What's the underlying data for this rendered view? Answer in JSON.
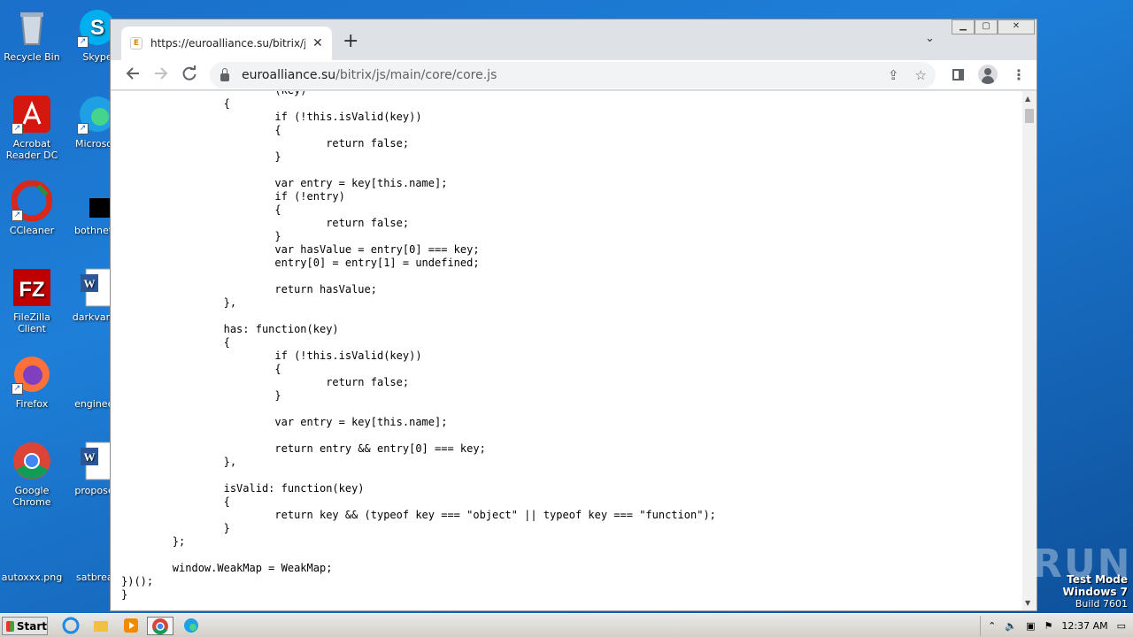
{
  "desktop": {
    "icons": [
      {
        "label": "Recycle Bin"
      },
      {
        "label": "Skype"
      },
      {
        "label": "Acrobat Reader DC"
      },
      {
        "label": "Microsoft"
      },
      {
        "label": "CCleaner"
      },
      {
        "label": "bothnetw"
      },
      {
        "label": "FileZilla Client"
      },
      {
        "label": "darkvariet"
      },
      {
        "label": "Firefox"
      },
      {
        "label": "engineeri"
      },
      {
        "label": "Google Chrome"
      },
      {
        "label": "proposed"
      },
      {
        "label": "autoxxx.png"
      },
      {
        "label": "satbreak"
      }
    ],
    "watermark": "ANY RUN",
    "test_mode": {
      "line1": "Test Mode",
      "line2": "Windows 7",
      "line3": "Build 7601"
    }
  },
  "browser": {
    "tab": {
      "title": "https://euroalliance.su/bitrix/js/main",
      "close": "✕"
    },
    "new_tab": "+",
    "tab_menu": "⌄",
    "url_host": "euroalliance.su",
    "url_path": "/bitrix/js/main/core/core.js",
    "window_controls": {
      "minimize": "▁",
      "maximize": "▢",
      "close": "✕"
    }
  },
  "code_lines": [
    "                        (key)",
    "                {",
    "                        if (!this.isValid(key))",
    "                        {",
    "                                return false;",
    "                        }",
    "",
    "                        var entry = key[this.name];",
    "                        if (!entry)",
    "                        {",
    "                                return false;",
    "                        }",
    "                        var hasValue = entry[0] === key;",
    "                        entry[0] = entry[1] = undefined;",
    "",
    "                        return hasValue;",
    "                },",
    "",
    "                has: function(key)",
    "                {",
    "                        if (!this.isValid(key))",
    "                        {",
    "                                return false;",
    "                        }",
    "",
    "                        var entry = key[this.name];",
    "",
    "                        return entry && entry[0] === key;",
    "                },",
    "",
    "                isValid: function(key)",
    "                {",
    "                        return key && (typeof key === \"object\" || typeof key === \"function\");",
    "                }",
    "        };",
    "",
    "        window.WeakMap = WeakMap;",
    "})();",
    "}"
  ],
  "taskbar": {
    "start_label": "Start",
    "clock": "12:37 AM"
  }
}
